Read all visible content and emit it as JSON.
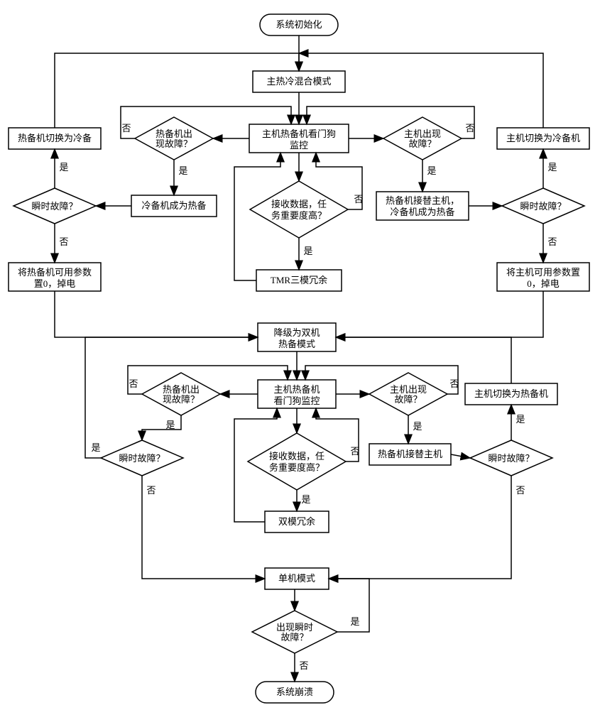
{
  "chart_data": {
    "type": "flowchart",
    "nodes": {
      "start": "系统初始化",
      "hotcold_mode": "主热冷混合模式",
      "watchdog1": "主机热备机看门狗监控",
      "hot_fail1": "热备机出现故障？",
      "host_fail1": "主机出现故障？",
      "recv1": "接收数据，任务重要度高？",
      "hot_to_cold": "热备机切换为冷备",
      "host_to_cold": "主机切换为冷备机",
      "cold_to_hot": "冷备机成为热备",
      "hot_take_host_cold_hot": "热备机接替主机，冷备机成为热备",
      "trans1L": "瞬时故障？",
      "trans1R": "瞬时故障？",
      "hot_unavail": "将热备机可用参数置0，掉电",
      "host_unavail": "将主机可用参数置0，掉电",
      "tmr": "TMR三模冗余",
      "downgrade_dual": "降级为双机热备模式",
      "watchdog2": "主机热备机看门狗监控",
      "hot_fail2": "热备机出现故障？",
      "host_fail2": "主机出现故障？",
      "recv2": "接收数据，任务重要度高？",
      "trans2L": "瞬时故障？",
      "trans2R": "瞬时故障？",
      "hot_take_host2": "热备机接替主机",
      "host_to_hot": "主机切换为热备机",
      "dual_redund": "双模冗余",
      "single": "单机模式",
      "trans3": "出现瞬时故障？",
      "crash": "系统崩溃"
    },
    "labels": {
      "yes": "是",
      "no": "否"
    },
    "edges": [
      [
        "start",
        "hotcold_mode"
      ],
      [
        "hotcold_mode",
        "watchdog1"
      ],
      [
        "watchdog1",
        "hot_fail1"
      ],
      [
        "watchdog1",
        "host_fail1"
      ],
      [
        "watchdog1",
        "recv1"
      ],
      [
        "hot_fail1",
        "cold_to_hot",
        "yes"
      ],
      [
        "hot_fail1",
        "watchdog1",
        "no"
      ],
      [
        "host_fail1",
        "hot_take_host_cold_hot",
        "yes"
      ],
      [
        "host_fail1",
        "watchdog1",
        "no"
      ],
      [
        "cold_to_hot",
        "trans1L"
      ],
      [
        "trans1L",
        "hot_to_cold",
        "yes"
      ],
      [
        "trans1L",
        "hot_unavail",
        "no"
      ],
      [
        "hot_to_cold",
        "hotcold_mode"
      ],
      [
        "hot_take_host_cold_hot",
        "trans1R"
      ],
      [
        "trans1R",
        "host_to_cold",
        "yes"
      ],
      [
        "trans1R",
        "host_unavail",
        "no"
      ],
      [
        "host_to_cold",
        "hotcold_mode"
      ],
      [
        "recv1",
        "tmr",
        "yes"
      ],
      [
        "recv1",
        "watchdog1",
        "no"
      ],
      [
        "tmr",
        "watchdog1"
      ],
      [
        "hot_unavail",
        "downgrade_dual"
      ],
      [
        "host_unavail",
        "downgrade_dual"
      ],
      [
        "downgrade_dual",
        "watchdog2"
      ],
      [
        "watchdog2",
        "hot_fail2"
      ],
      [
        "watchdog2",
        "host_fail2"
      ],
      [
        "watchdog2",
        "recv2"
      ],
      [
        "hot_fail2",
        "trans2L",
        "yes"
      ],
      [
        "hot_fail2",
        "watchdog2",
        "no"
      ],
      [
        "trans2L",
        "downgrade_dual",
        "yes"
      ],
      [
        "trans2L",
        "single",
        "no"
      ],
      [
        "host_fail2",
        "hot_take_host2",
        "yes"
      ],
      [
        "host_fail2",
        "watchdog2",
        "no"
      ],
      [
        "hot_take_host2",
        "trans2R"
      ],
      [
        "trans2R",
        "host_to_hot",
        "yes"
      ],
      [
        "trans2R",
        "single",
        "no"
      ],
      [
        "host_to_hot",
        "downgrade_dual"
      ],
      [
        "recv2",
        "dual_redund",
        "yes"
      ],
      [
        "recv2",
        "watchdog2",
        "no"
      ],
      [
        "dual_redund",
        "watchdog2"
      ],
      [
        "single",
        "trans3"
      ],
      [
        "trans3",
        "single",
        "yes"
      ],
      [
        "trans3",
        "crash",
        "no"
      ]
    ]
  },
  "L": {
    "yes": "是",
    "no": "否"
  },
  "N": {
    "start": "系统初始化",
    "hotcold_mode": "主热冷混合模式",
    "watchdog1a": "主机热备机看门狗",
    "watchdog1b": "监控",
    "hot_fail1a": "热备机出",
    "hot_fail1b": "现故障？",
    "host_fail1a": "主机出现",
    "host_fail1b": "故障？",
    "recv1a": "接收数据，任",
    "recv1b": "务重要度高？",
    "hot_to_cold": "热备机切换为冷备",
    "host_to_cold": "主机切换为冷备机",
    "cold_to_hot": "冷备机成为热备",
    "hot_take1a": "热备机接替主机，",
    "hot_take1b": "冷备机成为热备",
    "trans": "瞬时故障？",
    "hot_unavail_a": "将热备机可用参数",
    "hot_unavail_b": "置0，掉电",
    "host_unavail_a": "将主机可用参数置",
    "host_unavail_b": "0，掉电",
    "tmr": "TMR三模冗余",
    "dgrade_a": "降级为双机",
    "dgrade_b": "热备模式",
    "watchdog2a": "主机热备机",
    "watchdog2b": "看门狗监控",
    "hot_fail2a": "热备机出",
    "hot_fail2b": "现故障？",
    "host_fail2a": "主机出现",
    "host_fail2b": "故障？",
    "recv2a": "接收数据，任",
    "recv2b": "务重要度高？",
    "hot_take2": "热备机接替主机",
    "host_to_hot": "主机切换为热备机",
    "dual_redund": "双模冗余",
    "single": "单机模式",
    "trans3a": "出现瞬时",
    "trans3b": "故障？",
    "crash": "系统崩溃"
  }
}
